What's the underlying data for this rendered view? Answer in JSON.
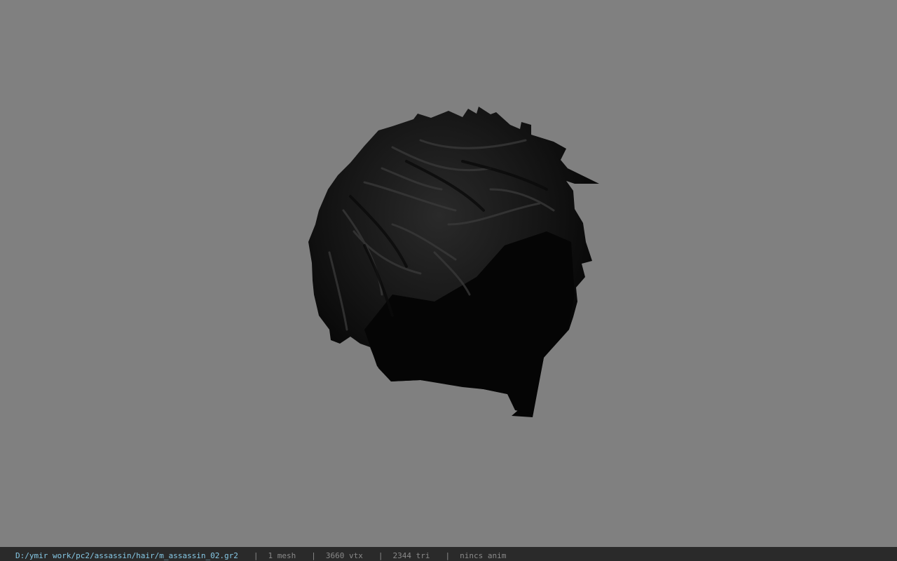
{
  "viewer": {
    "background_color": "#808080",
    "model_color": "#0e0e0e",
    "model": "hair-mesh"
  },
  "statusbar": {
    "path": "D:/ymir work/pc2/assassin/hair/m_assassin_02.gr2",
    "separator": "|",
    "mesh_count": "1 mesh",
    "vertex_count": "3660 vtx",
    "triangle_count": "2344 tri",
    "anim": "nincs anim",
    "colors": {
      "background": "#2a2a2a",
      "path": "#86c9e6",
      "text": "#8a8a8a"
    }
  }
}
